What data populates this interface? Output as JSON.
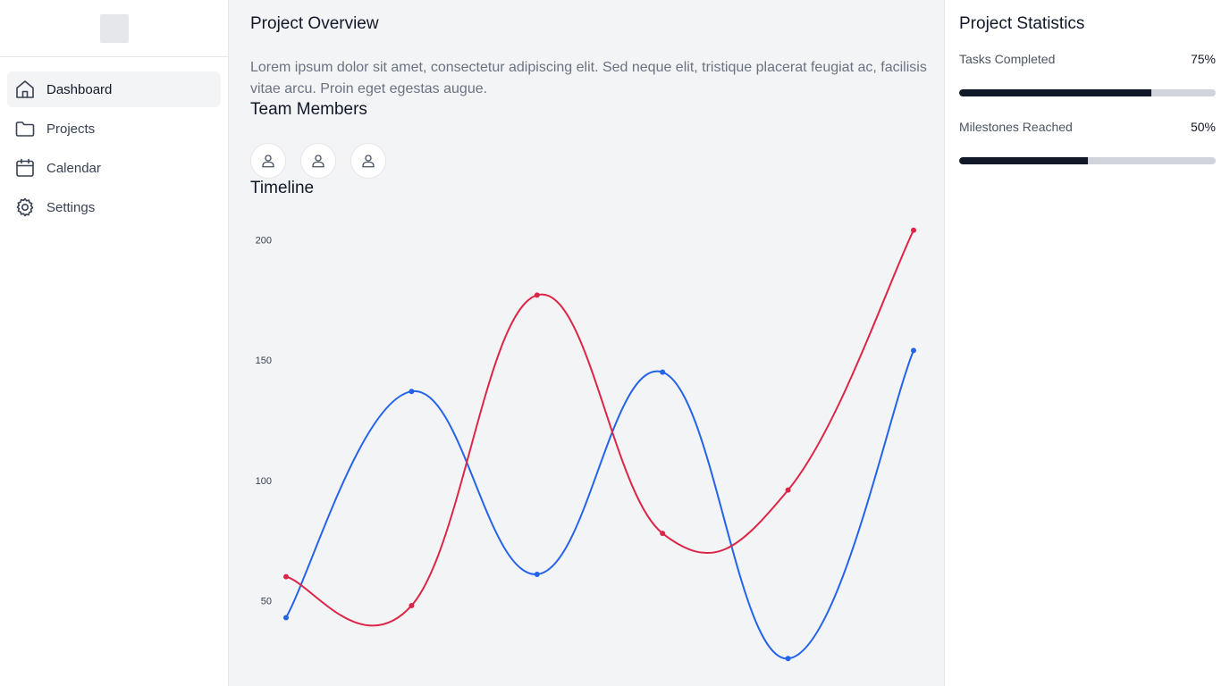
{
  "sidebar": {
    "items": [
      {
        "label": "Dashboard",
        "icon": "home-icon",
        "active": true
      },
      {
        "label": "Projects",
        "icon": "folder-icon",
        "active": false
      },
      {
        "label": "Calendar",
        "icon": "calendar-icon",
        "active": false
      },
      {
        "label": "Settings",
        "icon": "gear-icon",
        "active": false
      }
    ]
  },
  "main": {
    "overview_title": "Project Overview",
    "description": "Lorem ipsum dolor sit amet, consectetur adipiscing elit. Sed neque elit, tristique placerat feugiat ac, facilisis vitae arcu. Proin eget egestas augue.",
    "team_title": "Team Members",
    "members": [
      "user-icon",
      "user-icon",
      "user-icon"
    ],
    "timeline_title": "Timeline"
  },
  "chart_data": {
    "type": "line",
    "x": [
      0,
      1,
      2,
      3,
      4,
      5
    ],
    "ylim": [
      35,
      205
    ],
    "yticks": [
      50,
      100,
      150,
      200
    ],
    "series": [
      {
        "color": "#2563eb",
        "values": [
          43,
          137,
          61,
          145,
          26,
          154
        ]
      },
      {
        "color": "#dc2648",
        "values": [
          60,
          48,
          177,
          78,
          96,
          204
        ]
      }
    ]
  },
  "stats": {
    "title": "Project Statistics",
    "items": [
      {
        "label": "Tasks Completed",
        "value": "75%",
        "percent": 75
      },
      {
        "label": "Milestones Reached",
        "value": "50%",
        "percent": 50
      }
    ]
  },
  "colors": {
    "sidebar_active": "#f3f4f6",
    "main_bg": "#f3f4f6",
    "bar_fill": "#111827",
    "bar_track": "#d1d5db"
  }
}
